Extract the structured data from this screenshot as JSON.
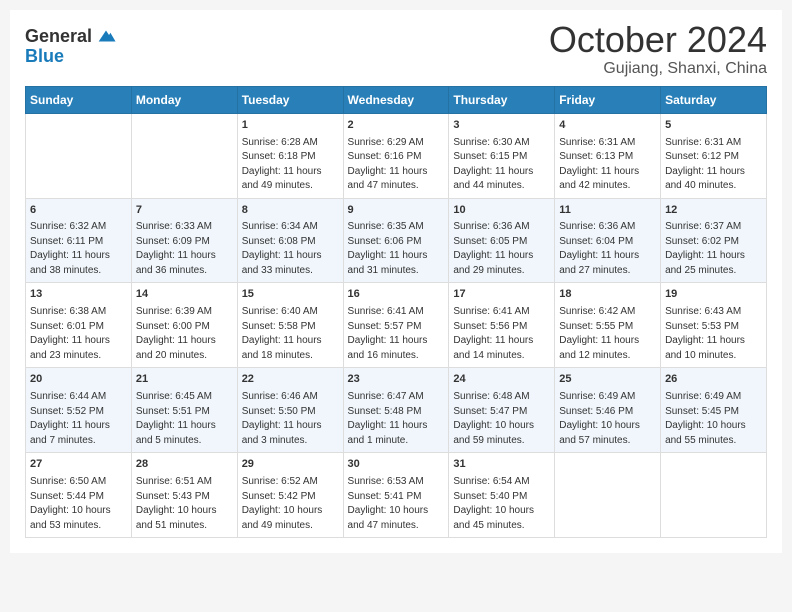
{
  "header": {
    "logo_line1": "General",
    "logo_line2": "Blue",
    "month": "October 2024",
    "location": "Gujiang, Shanxi, China"
  },
  "weekdays": [
    "Sunday",
    "Monday",
    "Tuesday",
    "Wednesday",
    "Thursday",
    "Friday",
    "Saturday"
  ],
  "weeks": [
    [
      {
        "day": "",
        "info": ""
      },
      {
        "day": "",
        "info": ""
      },
      {
        "day": "1",
        "info": "Sunrise: 6:28 AM\nSunset: 6:18 PM\nDaylight: 11 hours and 49 minutes."
      },
      {
        "day": "2",
        "info": "Sunrise: 6:29 AM\nSunset: 6:16 PM\nDaylight: 11 hours and 47 minutes."
      },
      {
        "day": "3",
        "info": "Sunrise: 6:30 AM\nSunset: 6:15 PM\nDaylight: 11 hours and 44 minutes."
      },
      {
        "day": "4",
        "info": "Sunrise: 6:31 AM\nSunset: 6:13 PM\nDaylight: 11 hours and 42 minutes."
      },
      {
        "day": "5",
        "info": "Sunrise: 6:31 AM\nSunset: 6:12 PM\nDaylight: 11 hours and 40 minutes."
      }
    ],
    [
      {
        "day": "6",
        "info": "Sunrise: 6:32 AM\nSunset: 6:11 PM\nDaylight: 11 hours and 38 minutes."
      },
      {
        "day": "7",
        "info": "Sunrise: 6:33 AM\nSunset: 6:09 PM\nDaylight: 11 hours and 36 minutes."
      },
      {
        "day": "8",
        "info": "Sunrise: 6:34 AM\nSunset: 6:08 PM\nDaylight: 11 hours and 33 minutes."
      },
      {
        "day": "9",
        "info": "Sunrise: 6:35 AM\nSunset: 6:06 PM\nDaylight: 11 hours and 31 minutes."
      },
      {
        "day": "10",
        "info": "Sunrise: 6:36 AM\nSunset: 6:05 PM\nDaylight: 11 hours and 29 minutes."
      },
      {
        "day": "11",
        "info": "Sunrise: 6:36 AM\nSunset: 6:04 PM\nDaylight: 11 hours and 27 minutes."
      },
      {
        "day": "12",
        "info": "Sunrise: 6:37 AM\nSunset: 6:02 PM\nDaylight: 11 hours and 25 minutes."
      }
    ],
    [
      {
        "day": "13",
        "info": "Sunrise: 6:38 AM\nSunset: 6:01 PM\nDaylight: 11 hours and 23 minutes."
      },
      {
        "day": "14",
        "info": "Sunrise: 6:39 AM\nSunset: 6:00 PM\nDaylight: 11 hours and 20 minutes."
      },
      {
        "day": "15",
        "info": "Sunrise: 6:40 AM\nSunset: 5:58 PM\nDaylight: 11 hours and 18 minutes."
      },
      {
        "day": "16",
        "info": "Sunrise: 6:41 AM\nSunset: 5:57 PM\nDaylight: 11 hours and 16 minutes."
      },
      {
        "day": "17",
        "info": "Sunrise: 6:41 AM\nSunset: 5:56 PM\nDaylight: 11 hours and 14 minutes."
      },
      {
        "day": "18",
        "info": "Sunrise: 6:42 AM\nSunset: 5:55 PM\nDaylight: 11 hours and 12 minutes."
      },
      {
        "day": "19",
        "info": "Sunrise: 6:43 AM\nSunset: 5:53 PM\nDaylight: 11 hours and 10 minutes."
      }
    ],
    [
      {
        "day": "20",
        "info": "Sunrise: 6:44 AM\nSunset: 5:52 PM\nDaylight: 11 hours and 7 minutes."
      },
      {
        "day": "21",
        "info": "Sunrise: 6:45 AM\nSunset: 5:51 PM\nDaylight: 11 hours and 5 minutes."
      },
      {
        "day": "22",
        "info": "Sunrise: 6:46 AM\nSunset: 5:50 PM\nDaylight: 11 hours and 3 minutes."
      },
      {
        "day": "23",
        "info": "Sunrise: 6:47 AM\nSunset: 5:48 PM\nDaylight: 11 hours and 1 minute."
      },
      {
        "day": "24",
        "info": "Sunrise: 6:48 AM\nSunset: 5:47 PM\nDaylight: 10 hours and 59 minutes."
      },
      {
        "day": "25",
        "info": "Sunrise: 6:49 AM\nSunset: 5:46 PM\nDaylight: 10 hours and 57 minutes."
      },
      {
        "day": "26",
        "info": "Sunrise: 6:49 AM\nSunset: 5:45 PM\nDaylight: 10 hours and 55 minutes."
      }
    ],
    [
      {
        "day": "27",
        "info": "Sunrise: 6:50 AM\nSunset: 5:44 PM\nDaylight: 10 hours and 53 minutes."
      },
      {
        "day": "28",
        "info": "Sunrise: 6:51 AM\nSunset: 5:43 PM\nDaylight: 10 hours and 51 minutes."
      },
      {
        "day": "29",
        "info": "Sunrise: 6:52 AM\nSunset: 5:42 PM\nDaylight: 10 hours and 49 minutes."
      },
      {
        "day": "30",
        "info": "Sunrise: 6:53 AM\nSunset: 5:41 PM\nDaylight: 10 hours and 47 minutes."
      },
      {
        "day": "31",
        "info": "Sunrise: 6:54 AM\nSunset: 5:40 PM\nDaylight: 10 hours and 45 minutes."
      },
      {
        "day": "",
        "info": ""
      },
      {
        "day": "",
        "info": ""
      }
    ]
  ]
}
